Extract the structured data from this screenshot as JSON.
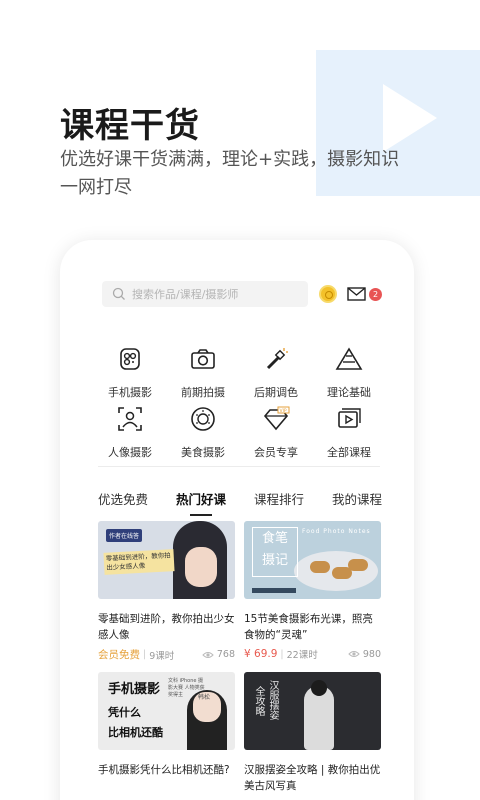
{
  "hero": {
    "title": "课程干货",
    "subtitle": "优选好课干货满满，理论+实践，摄影知识一网打尽"
  },
  "header": {
    "search_placeholder": "搜索作品/课程/摄影师",
    "mail_badge": "2"
  },
  "categories": [
    {
      "label": "手机摄影",
      "icon": "phone-camera-icon"
    },
    {
      "label": "前期拍摄",
      "icon": "camera-icon"
    },
    {
      "label": "后期调色",
      "icon": "magic-wand-icon"
    },
    {
      "label": "理论基础",
      "icon": "pyramid-icon"
    },
    {
      "label": "人像摄影",
      "icon": "portrait-icon"
    },
    {
      "label": "美食摄影",
      "icon": "plate-icon"
    },
    {
      "label": "会员专享",
      "icon": "vip-diamond-icon"
    },
    {
      "label": "全部课程",
      "icon": "video-stack-icon"
    }
  ],
  "tabs": [
    {
      "label": "优选免费",
      "active": false
    },
    {
      "label": "热门好课",
      "active": true
    },
    {
      "label": "课程排行",
      "active": false
    },
    {
      "label": "我的课程",
      "active": false
    }
  ],
  "courses": [
    {
      "title": "零基础到进阶，教你拍出少女感人像",
      "price": "会员免费",
      "lessons": "9课时",
      "views": "768",
      "thumb": {
        "tag": "作者在线答",
        "caption": "零基础到进阶，教你拍出少女感人像"
      }
    },
    {
      "title": "15节美食摄影布光课，照亮食物的“灵魂”",
      "price": "¥ 69.9",
      "lessons": "22课时",
      "views": "980",
      "thumb": {
        "line1": "食笔",
        "line2": "摄记",
        "eng": "Food Photo Notes"
      }
    },
    {
      "title": "手机摄影凭什么比相机还酷?",
      "thumb": {
        "line1": "手机摄影",
        "line2": "凭什么",
        "line3": "比相机还酷",
        "note": "文科 iPhone 摄影大赛 人物类获奖得主",
        "signature": "韩松"
      }
    },
    {
      "title": "汉服摆姿全攻略 | 教你拍出优美古风写真",
      "thumb": {
        "col1": "汉服摆姿",
        "col2": "全攻略"
      }
    }
  ],
  "colors": {
    "hero_deco": "#e6f1fc",
    "price_red": "#e85a4f",
    "free_orange": "#e6a23c",
    "badge_red": "#e85454"
  }
}
